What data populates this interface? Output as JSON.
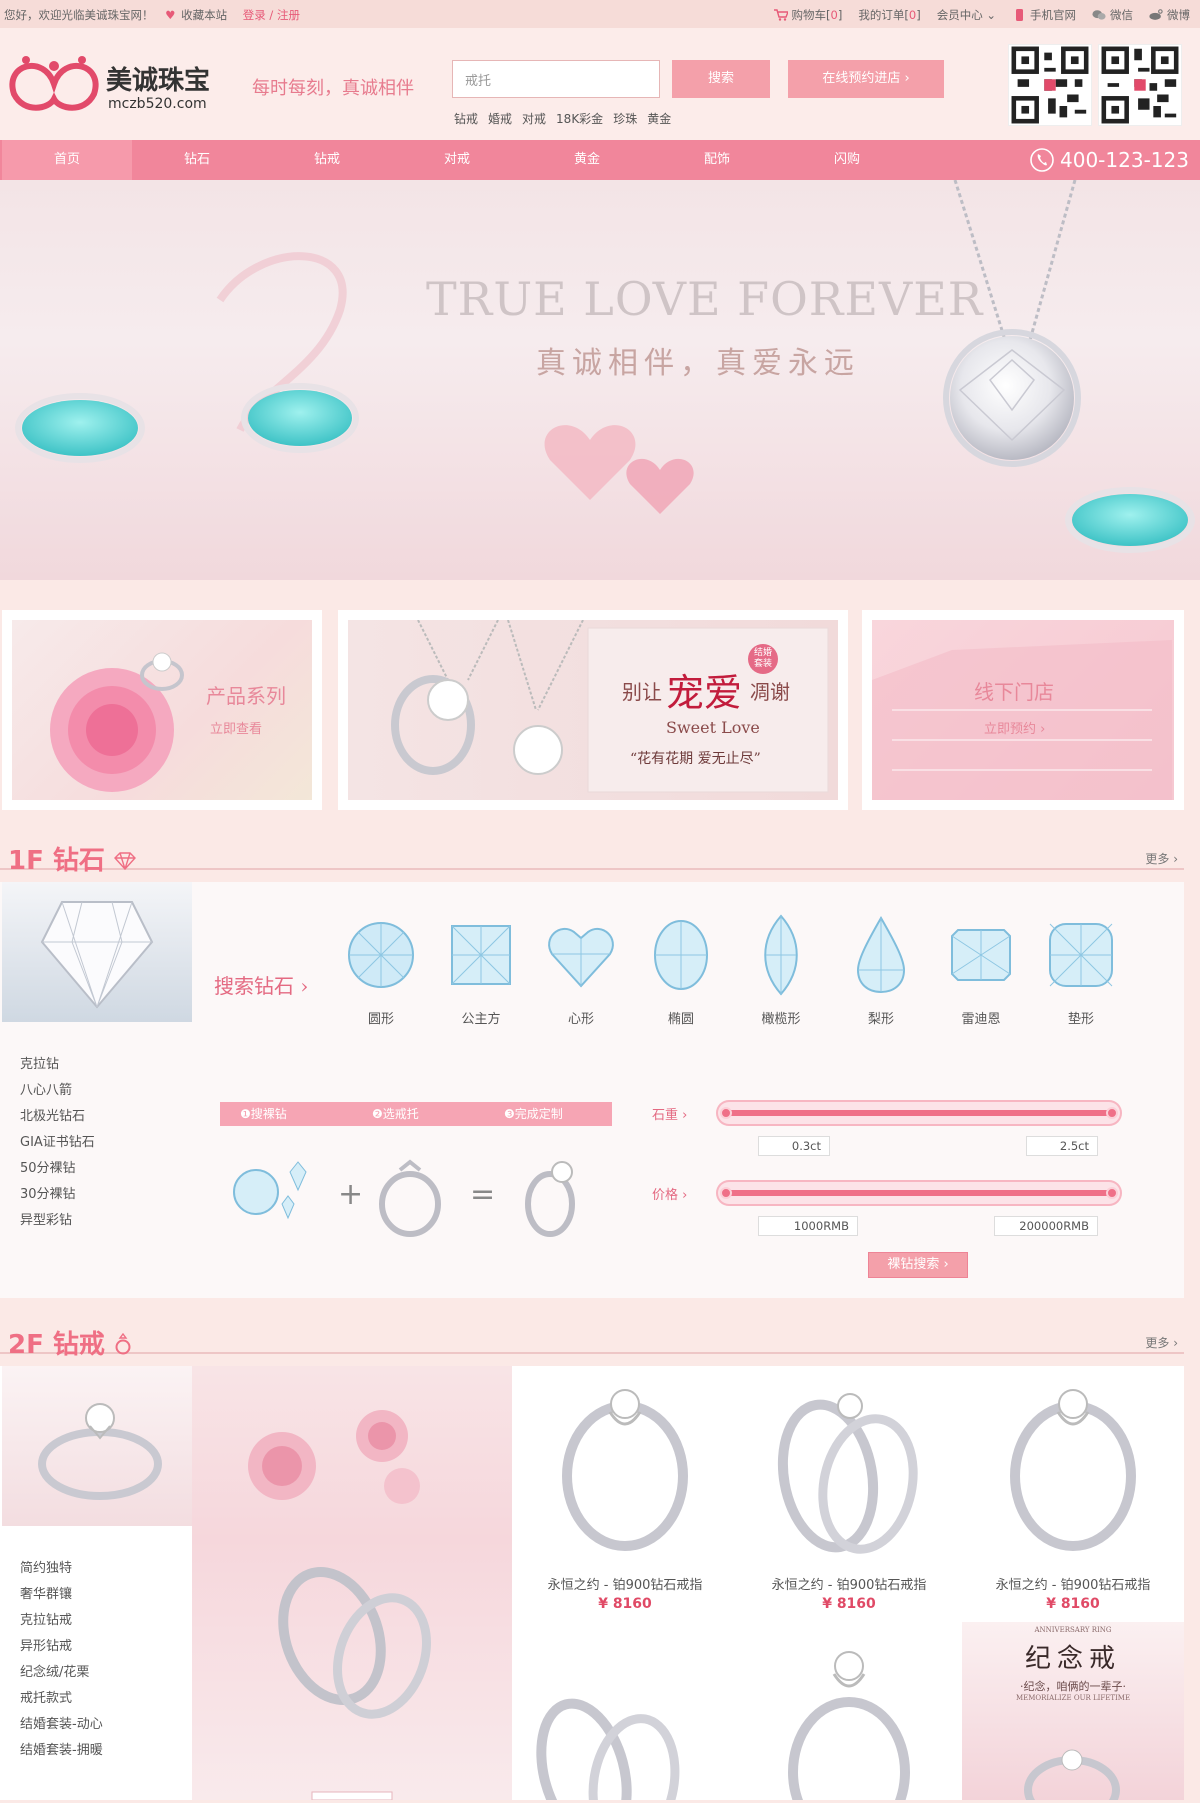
{
  "topbar": {
    "welcome": "您好，欢迎光临美诚珠宝网！",
    "favorite": "收藏本站",
    "login": "登录 / 注册",
    "cart_label": "购物车[",
    "cart_count": "0",
    "cart_close": "]",
    "orders_label": "我的订单[",
    "orders_count": "0",
    "orders_close": "]",
    "member": "会员中心",
    "mobile": "手机官网",
    "wechat": "微信",
    "weibo": "微博"
  },
  "header": {
    "brand_name": "美诚珠宝",
    "brand_domain": "mczb520.com",
    "slogan": "每时每刻，真诚相伴",
    "search_placeholder": "戒托",
    "search_button": "搜索",
    "reserve_button": "在线预约进店 ›",
    "hot_keywords": [
      "钻戒",
      "婚戒",
      "对戒",
      "18K彩金",
      "珍珠",
      "黄金"
    ]
  },
  "nav": {
    "items": [
      "首页",
      "钻石",
      "钻戒",
      "对戒",
      "黄金",
      "配饰",
      "闪购"
    ],
    "phone": "400-123-123"
  },
  "banner": {
    "title_en": "TRUE LOVE FOREVER",
    "title_cn": "真诚相伴，真爱永远"
  },
  "promos": {
    "p1_title": "产品系列",
    "p1_link": "立即查看",
    "p2_prefix": "别让",
    "p2_big": "宠爱",
    "p2_suffix": "凋谢",
    "p2_badge": "结婚套装",
    "p2_en": "Sweet Love",
    "p2_quote": "“花有花期 爱无止尽”",
    "p3_title": "线下门店",
    "p3_link": "立即预约 ›"
  },
  "f1": {
    "title": "1F 钻石",
    "more": "更多 ›",
    "search_label": "搜索钻石 ›",
    "shapes": [
      "圆形",
      "公主方",
      "心形",
      "椭圆",
      "橄榄形",
      "梨形",
      "雷迪恩",
      "垫形"
    ],
    "side_list": [
      "克拉钻",
      "八心八箭",
      "北极光钻石",
      "GIA证书钻石",
      "50分裸钻",
      "30分裸钻",
      "异型彩钻"
    ],
    "steps": [
      "❶搜裸钻",
      "❷选戒托",
      "❸完成定制"
    ],
    "weight_label": "石重 ›",
    "weight_min": "0.3ct",
    "weight_max": "2.5ct",
    "price_label": "价格 ›",
    "price_min": "1000RMB",
    "price_max": "200000RMB",
    "search_button": "裸钻搜索 ›"
  },
  "f2": {
    "title": "2F 钻戒",
    "more": "更多 ›",
    "side_list": [
      "简约独特",
      "奢华群镶",
      "克拉钻戒",
      "异形钻戒",
      "纪念绒/花栗",
      "戒托款式",
      "结婚套装-动心",
      "结婚套装-拥暖"
    ],
    "products": [
      {
        "name": "永恒之约 - 铂900钻石戒指",
        "price": "¥ 8160"
      },
      {
        "name": "永恒之约 - 铂900钻石戒指",
        "price": "¥ 8160"
      },
      {
        "name": "永恒之约 - 铂900钻石戒指",
        "price": "¥ 8160"
      }
    ],
    "ad_small": "ANNIVERSARY RING",
    "ad_title": "纪念戒",
    "ad_sub": "·纪念，咱俩的一辈子·",
    "ad_en": "MEMORIALIZE OUR LIFETIME"
  },
  "colors": {
    "accent": "#f1869b",
    "price": "#e04a66",
    "bg": "#fbe9e6"
  }
}
